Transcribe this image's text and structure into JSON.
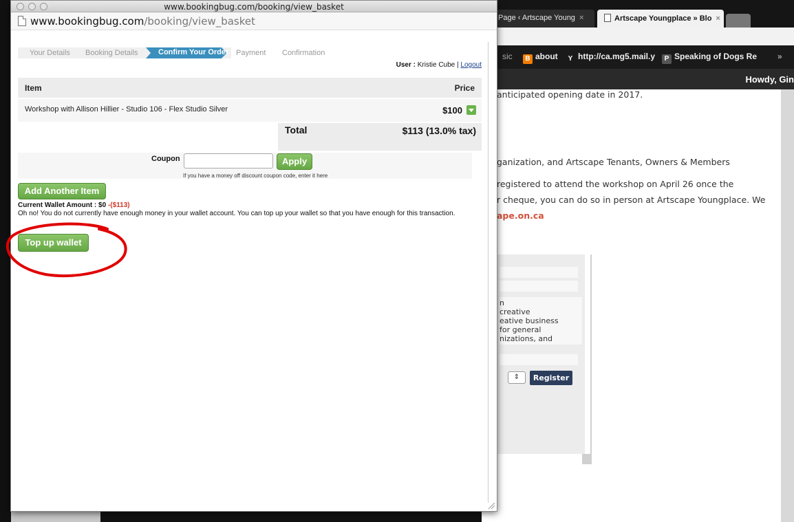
{
  "background": {
    "tabs": [
      {
        "label": "Page ‹ Artscape Young",
        "active": false
      },
      {
        "label": "Artscape Youngplace » Blo",
        "active": true
      }
    ],
    "bookmarks": [
      {
        "label": "sic"
      },
      {
        "label": "about",
        "icon": "blogger-icon"
      },
      {
        "label": "http://ca.mg5.mail.y",
        "icon": "yahoo-icon"
      },
      {
        "label": "Speaking of Dogs Re",
        "icon": "pin-icon"
      },
      {
        "label": "»"
      }
    ],
    "admin_greeting": "Howdy, Gin",
    "lines": [
      "anticipated opening date in 2017.",
      "ganization, and Artscape Tenants, Owners & Members",
      "registered to attend the workshop on April 26 once the",
      "r cheque, you can do so in person at Artscape Youngplace. We",
      "ape.on.ca"
    ],
    "form_text": [
      "n",
      "creative",
      "eative business",
      "for general",
      "nizations, and"
    ],
    "register_label": "Register"
  },
  "popup": {
    "window_title": "www.bookingbug.com/booking/view_basket",
    "url_host": "www.bookingbug.com",
    "url_path": "/booking/view_basket",
    "steps": [
      "Your Details",
      "Booking Details",
      "Confirm Your Order",
      "Payment",
      "Confirmation"
    ],
    "active_step": 2,
    "user_label": "User :",
    "user_name": "Kristie Cube",
    "separator": "|",
    "logout_label": "Logout",
    "table": {
      "col_item": "Item",
      "col_price": "Price",
      "rows": [
        {
          "description": "Workshop with Allison Hillier - Studio 106 - Flex Studio Silver",
          "price": "$100"
        }
      ],
      "total_label": "Total",
      "total_value": "$113 (13.0% tax)"
    },
    "coupon": {
      "label": "Coupon",
      "value": "",
      "apply_label": "Apply",
      "help": "If you have a money off discount coupon code, enter it here"
    },
    "add_item_label": "Add Another Item",
    "wallet": {
      "label": "Current Wallet Amount : $0",
      "shortfall": "-($113)",
      "message": "Oh no! You do not currently have enough money in your wallet account. You can top up your wallet so that you have enough for this transaction."
    },
    "topup_label": "Top up wallet",
    "highlight_color": "#e00000"
  }
}
